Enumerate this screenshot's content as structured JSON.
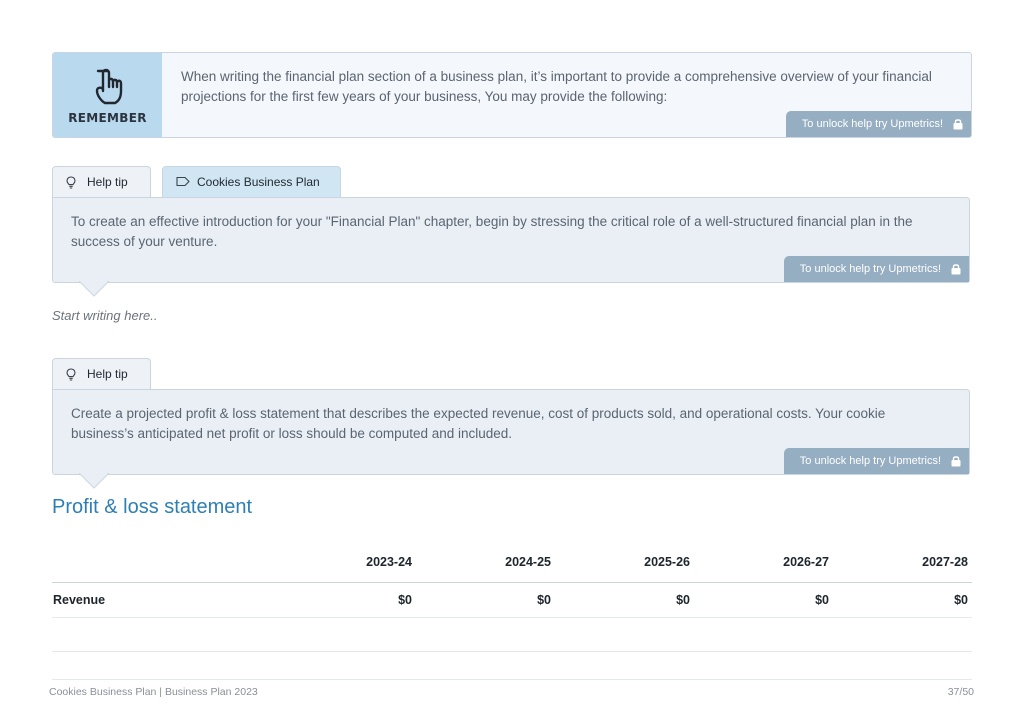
{
  "remember": {
    "label": "REMEMBER",
    "text": "When writing the financial plan section of a business plan, it’s important to provide a comprehensive overview of your financial projections for the first few years of your business, You may provide the following:",
    "unlock": "To unlock help try Upmetrics!"
  },
  "tip1": {
    "tab_help": "Help tip",
    "tab_plan": "Cookies Business Plan",
    "text": "To create an effective introduction for your \"Financial Plan\" chapter, begin by stressing the critical role of a well-structured financial plan in the success of your venture.",
    "unlock": "To unlock help try Upmetrics!"
  },
  "editor": {
    "placeholder": "Start writing here.."
  },
  "tip2": {
    "tab_help": "Help tip",
    "text": "Create a projected profit & loss statement that describes the expected revenue, cost of products sold, and operational costs. Your cookie business’s anticipated net profit or loss should be computed and included.",
    "unlock": "To unlock help try Upmetrics!"
  },
  "pl": {
    "title": "Profit & loss statement",
    "columns": [
      "2023-24",
      "2024-25",
      "2025-26",
      "2026-27",
      "2027-28"
    ],
    "rows": [
      {
        "label": "Revenue",
        "values": [
          "$0",
          "$0",
          "$0",
          "$0",
          "$0"
        ]
      }
    ]
  },
  "footer": {
    "left": "Cookies Business Plan | Business Plan 2023",
    "right": "37/50"
  },
  "colors": {
    "accent": "#2e7fb4",
    "remember_bg": "#b9d9ef",
    "tip_bg": "#eaeff6",
    "unlock_bg": "#95aec2"
  }
}
